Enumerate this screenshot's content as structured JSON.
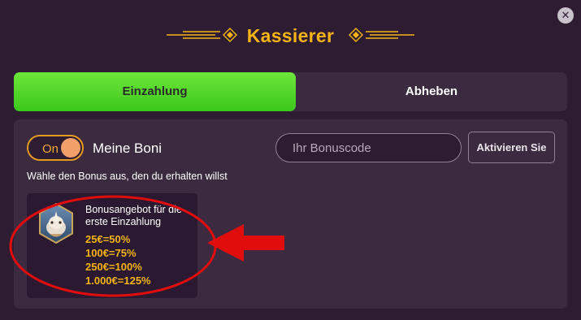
{
  "header": {
    "title": "Kassierer",
    "close_icon": "close-icon",
    "close_glyph": "✕"
  },
  "tabs": [
    {
      "label": "Einzahlung",
      "active": true
    },
    {
      "label": "Abheben",
      "active": false
    }
  ],
  "bonus": {
    "toggle_label": "On",
    "toggle_state": true,
    "section_label": "Meine Boni",
    "code_placeholder": "Ihr Bonuscode",
    "activate_label": "Aktivieren Sie",
    "hint": "Wähle den Bonus aus, den du erhalten willst",
    "offers": [
      {
        "icon": "rhino-avatar-icon",
        "title": "Bonusangebot für die erste Einzahlung",
        "tiers": [
          "25€=50%",
          "100€=75%",
          "250€=100%",
          "1.000€=125%"
        ]
      }
    ]
  },
  "colors": {
    "background": "#2e1c33",
    "panel": "#3b2a40",
    "accent_gold": "#f5b414",
    "active_tab": "#4fd52a",
    "annotation_red": "#e00d0d"
  }
}
